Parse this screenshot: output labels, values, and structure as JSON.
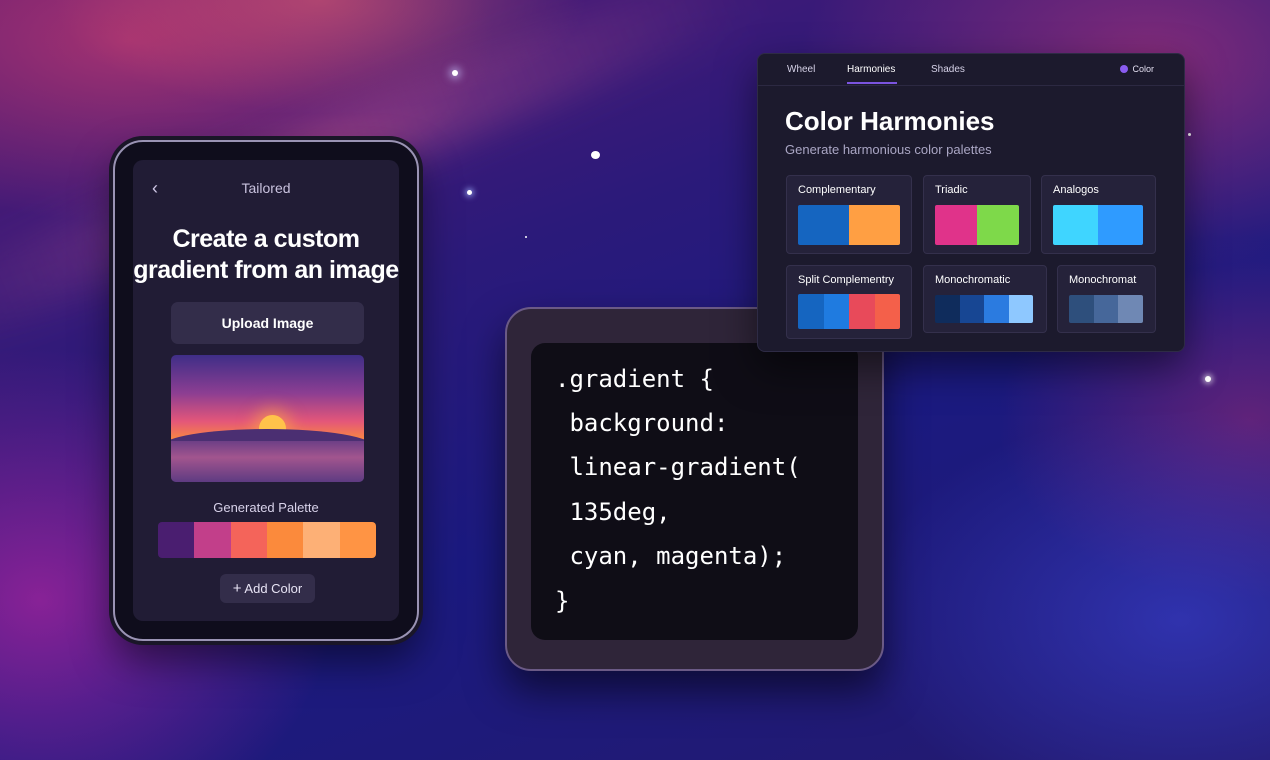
{
  "phone": {
    "title": "Tailored",
    "back_icon": "chevron-left-icon",
    "headline_line1": "Create a custom",
    "headline_line2": "gradient from an image",
    "upload_button": "Upload Image",
    "palette_label": "Generated Palette",
    "palette": [
      "#4a1e70",
      "#c23f8a",
      "#f4645a",
      "#fb8a3c",
      "#fdb076",
      "#ff9444"
    ],
    "add_color": "Add Color",
    "add_icon": "plus-icon"
  },
  "code": {
    "lines": [
      ".gradient {",
      " background:",
      " linear-gradient(",
      " 135deg,",
      " cyan, magenta);",
      "}"
    ]
  },
  "harmonies": {
    "tabs": [
      "Wheel",
      "Harmonies",
      "Shades"
    ],
    "active_tab": "Harmonies",
    "color_label": "Color",
    "title": "Color Harmonies",
    "subtitle": "Generate harmonious color palettes",
    "cards": [
      {
        "label": "Complementary",
        "colors": [
          "#1565c0",
          "#ff9f43"
        ]
      },
      {
        "label": "Triadic",
        "colors": [
          "#e0338a",
          "#7ed94a"
        ]
      },
      {
        "label": "Analogos",
        "colors": [
          "#3fd5ff",
          "#2f9bff"
        ]
      },
      {
        "label": "Split Complementry",
        "colors": [
          "#1565c0",
          "#1f7be0",
          "#e84a5a",
          "#f4604a"
        ]
      },
      {
        "label": "Monochromatic",
        "colors": [
          "#0f2c5c",
          "#174693",
          "#2b7be0",
          "#8ec8ff"
        ]
      },
      {
        "label": "Monochromat",
        "colors": [
          "#2e4f7c",
          "#46679a",
          "#6f88b4"
        ]
      }
    ]
  }
}
